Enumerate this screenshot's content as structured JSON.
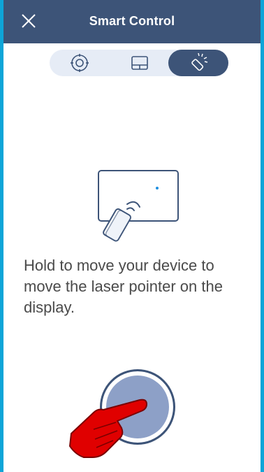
{
  "header": {
    "title": "Smart Control",
    "close_icon": "close-icon",
    "background": "#3d5478"
  },
  "tabs": [
    {
      "icon": "crosshair-icon",
      "selected": false
    },
    {
      "icon": "trackpad-icon",
      "selected": false
    },
    {
      "icon": "laser-pointer-icon",
      "selected": true
    }
  ],
  "illustration": {
    "icon": "laser-pointer-display-illustration"
  },
  "instruction": "Hold to move your device to move the laser pointer on the display.",
  "laser_button": {
    "icon": "hold-button",
    "fill": "#8da0c7"
  },
  "hint": {
    "icon": "pointing-hand-icon",
    "color": "#e00000"
  }
}
